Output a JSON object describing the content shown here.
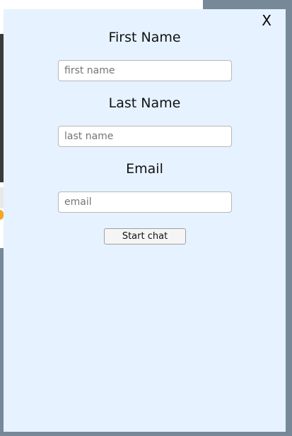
{
  "modal": {
    "close_label": "X",
    "fields": [
      {
        "label": "First Name",
        "placeholder": "first name"
      },
      {
        "label": "Last Name",
        "placeholder": "last name"
      },
      {
        "label": "Email",
        "placeholder": "email"
      }
    ],
    "submit_label": "Start chat"
  },
  "colors": {
    "backdrop": "#778899",
    "modal_background": "#e6f2ff"
  }
}
